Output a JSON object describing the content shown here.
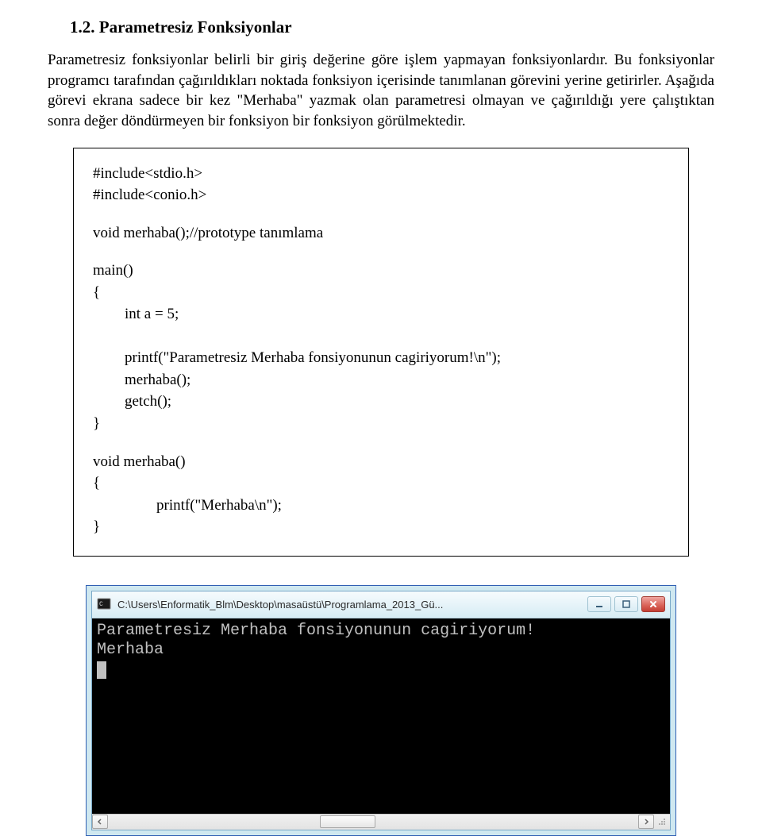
{
  "doc": {
    "heading": "1.2. Parametresiz Fonksiyonlar",
    "para": "Parametresiz fonksiyonlar belirli bir giriş değerine göre işlem yapmayan fonksiyonlardır. Bu fonksiyonlar programcı tarafından çağırıldıkları noktada fonksiyon içerisinde tanımlanan görevini yerine getirirler. Aşağıda görevi ekrana sadece bir kez \"Merhaba\" yazmak olan parametresi olmayan ve çağırıldığı yere çalıştıktan sonra değer döndürmeyen bir fonksiyon bir fonksiyon görülmektedir.",
    "code": {
      "l1": "#include<stdio.h>",
      "l2": "#include<conio.h>",
      "l3": "void merhaba();//prototype tanımlama",
      "l4": "main()",
      "l5": "{",
      "l6": "int a = 5;",
      "l7": "printf(\"Parametresiz Merhaba fonsiyonunun cagiriyorum!\\n\");",
      "l8": "merhaba();",
      "l9": "getch();",
      "l10": "}",
      "l11": "void merhaba()",
      "l12": "{",
      "l13": "printf(\"Merhaba\\n\");",
      "l14": "}"
    }
  },
  "console": {
    "title": "C:\\Users\\Enformatik_Blm\\Desktop\\masaüstü\\Programlama_2013_Gü...",
    "line1": "Parametresiz Merhaba fonsiyonunun cagiriyorum!",
    "line2": "Merhaba"
  }
}
